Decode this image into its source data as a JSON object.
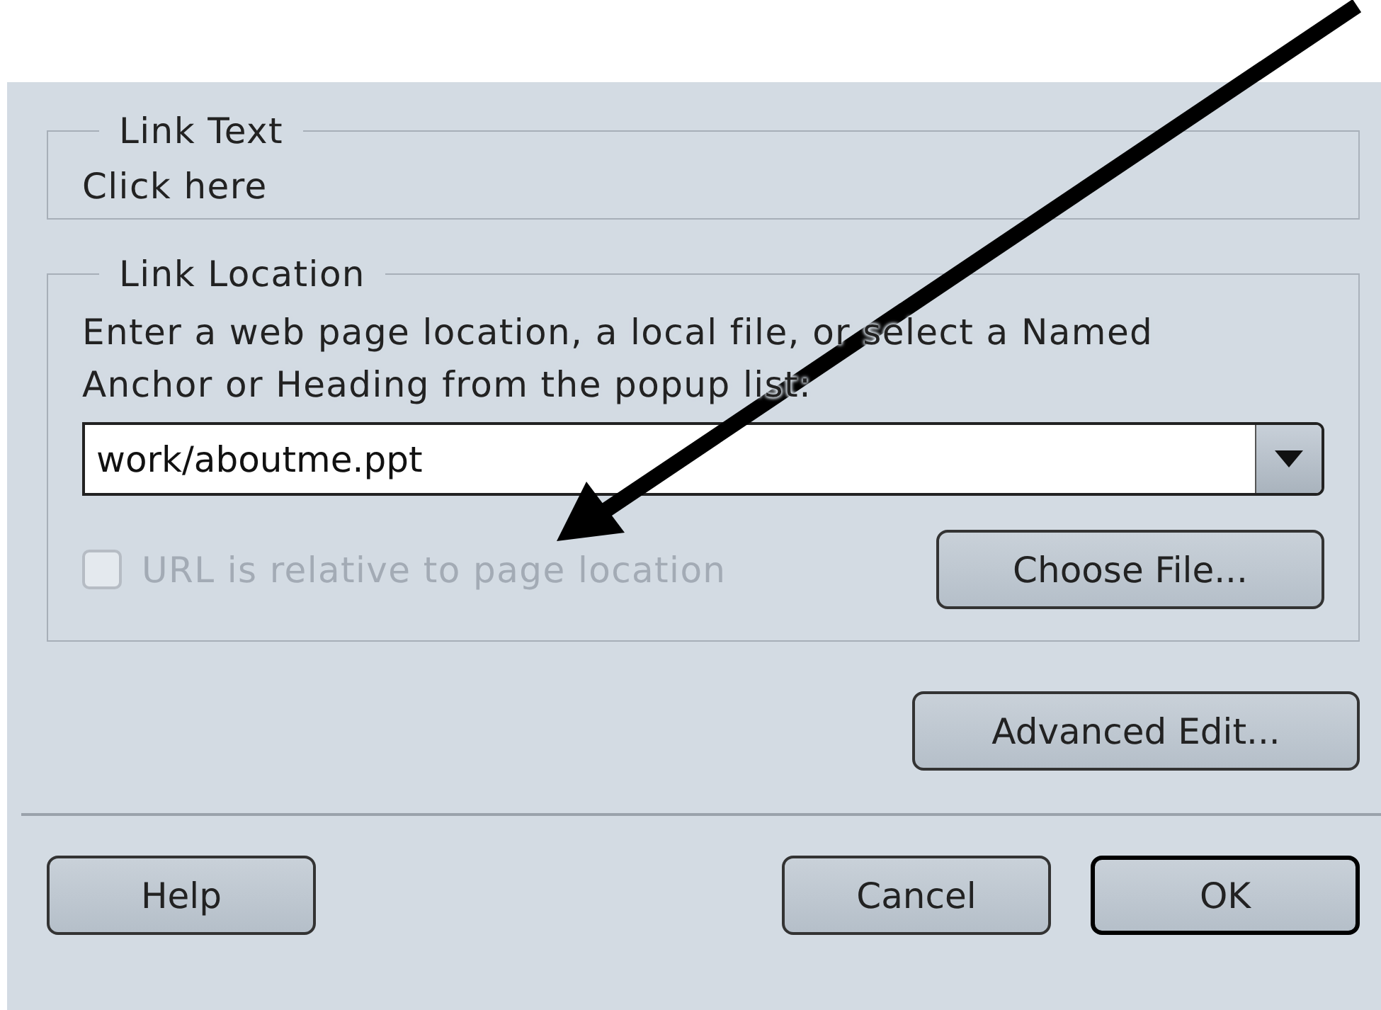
{
  "link_text": {
    "legend": "Link Text",
    "value": "Click here"
  },
  "link_location": {
    "legend": "Link Location",
    "description": "Enter a web page location, a local file, or select a Named Anchor or Heading from the popup list:",
    "url": "work/aboutme.ppt",
    "relative": {
      "label": "URL is relative to page location",
      "checked": false,
      "disabled": true
    },
    "choose_button": "Choose File..."
  },
  "advanced_button": "Advanced Edit...",
  "buttons": [
    {
      "label": "Help",
      "default": false
    },
    {
      "label": "Cancel",
      "default": false
    },
    {
      "label": "OK",
      "default": true
    }
  ]
}
